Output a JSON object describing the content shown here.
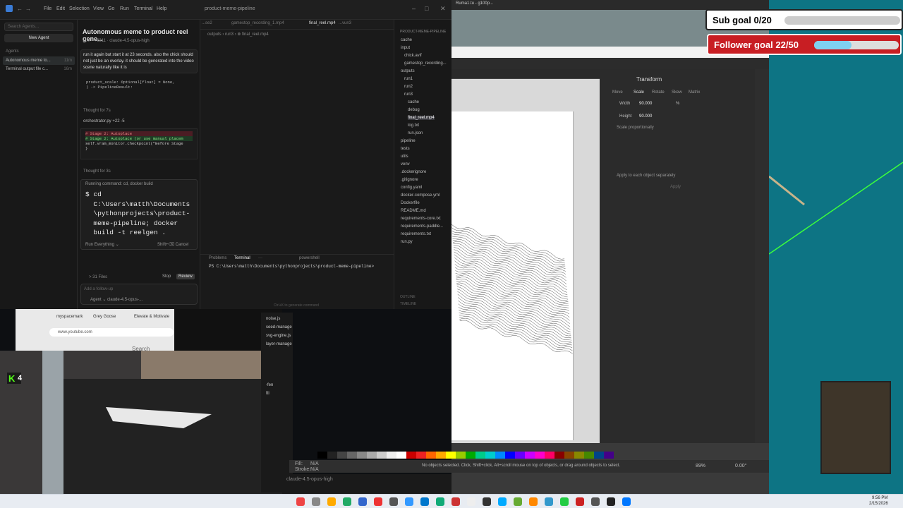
{
  "ide": {
    "menu": [
      "File",
      "Edit",
      "Selection",
      "View",
      "Go",
      "Run",
      "Terminal",
      "Help"
    ],
    "window_title": "product-meme-pipeline",
    "search_placeholder": "Search Agents...",
    "new_agent": "New Agent",
    "agents_label": "Agents",
    "agents": [
      {
        "label": "Autonomous meme to...",
        "time": "11m"
      },
      {
        "label": "Terminal output file c...",
        "time": "16m"
      }
    ],
    "chat": {
      "title": "Autonomous meme to product reel gene...",
      "meta": "11m · +6311 · claude-4.5-opus-high",
      "user_message": "run it again but start it at 23 seconds. also the chick should not just be an overlay. it should be generated into the video scene naturally like it is",
      "code_line1": "product_scale: Optional[float] = None,",
      "code_line2": ") -> PipelineResult:",
      "thought1": "Thought for 7s",
      "diff_file": "orchestrator.py  +22 -5",
      "diff_removed": "# Stage 2: Autoplace",
      "diff_added": "# Stage 2: Autoplace (or use manual placem",
      "diff_line3": "self.vram_monitor.checkpoint(\"Before Stage",
      "diff_line4": "}",
      "thought2": "Thought for 3s",
      "run_header": "Running command: cd, docker build",
      "run_code": "$ cd\n  C:\\Users\\matth\\Documents\n  \\pythonprojects\\product-\n  meme-pipeline; docker\n  build -t reelgen .",
      "run_everything": "Run Everything ⌄",
      "run_shortcut": "Shift+⌫ Cancel",
      "files_count": "> 31 Files",
      "stop": "Stop",
      "review": "Review",
      "followup_placeholder": "Add a follow-up",
      "agent_select": "Agent ⌄  claude-4.5-opus-..."
    },
    "editor": {
      "tabs": [
        "...se2",
        "gamestop_recording_1.mp4",
        "final_reel.mp4",
        "...vun3"
      ],
      "breadcrumb": "outputs › run3 › ⊗ final_reel.mp4",
      "terminal_tabs": [
        "Problems",
        "Terminal",
        "···"
      ],
      "shell": "powershell",
      "prompt": "PS C:\\Users\\matth\\Documents\\pythonprojects\\product-meme-pipeline>",
      "hint": "Ctrl+K to generate command"
    },
    "explorer": {
      "header": "PRODUCT-MEME-PIPELINE",
      "items": [
        "cache",
        "input",
        "chick.avif",
        "gamestop_recording...",
        "outputs",
        "run1",
        "run2",
        "run3",
        "cache",
        "debug",
        "final_reel.mp4",
        "log.txt",
        "run.json",
        "pipeline",
        "tests",
        "utils",
        "venv",
        ".dockerignore",
        ".gitignore",
        "config.yaml",
        "docker-compose.yml",
        "Dockerfile",
        "README.md",
        "requirements-core.txt",
        "requirements-paddle...",
        "requirements.txt",
        "run.py"
      ],
      "footer1": "OUTLINE",
      "footer2": "TIMELINE"
    }
  },
  "inkscape": {
    "title": "Ruma1.tu - g100p...",
    "panel_title": "Transform",
    "tabs": [
      "Move",
      "Scale",
      "Rotate",
      "Skew",
      "Matrix"
    ],
    "width_label": "Width",
    "width_value": "90.000",
    "height_label": "Height",
    "height_value": "90.000",
    "unit": "%",
    "scale_prop": "Scale proportionally",
    "apply_each": "Apply to each object separately",
    "apply": "Apply",
    "status_msg": "No objects selected. Click, Shift+click, Alt+scroll mouse on top of objects, or drag around objects to select.",
    "fill_label": "Fill:",
    "fill_value": "N/A",
    "stroke_label": "Stroke:",
    "stroke_value": "N/A",
    "zoom": "89%",
    "rotation": "0.00°"
  },
  "browser": {
    "tabs": [
      "myspacemark",
      "Grey Goose",
      "Elevate & Motivate"
    ],
    "url": "www.youtube.com",
    "search": "Search"
  },
  "side_list": [
    "noise.js",
    "seed-manage",
    "svg-engine.js",
    "layer-manage",
    "-fen",
    "ftl"
  ],
  "stream": {
    "kick_letter": "K",
    "kick_count": "4",
    "sub_goal": "Sub goal 0/20",
    "sub_progress": 0.0,
    "follower_goal": "Follower goal 22/50",
    "follower_progress": 0.44
  },
  "taskbar": {
    "time": "9:56 PM",
    "date": "2/15/2026",
    "status_model": "claude-4.5-opus-high"
  },
  "colors": {
    "accent_blue": "#0078d4",
    "kick_green": "#53fc18",
    "follower_red": "#c81e23",
    "goal_blue": "#7fd0f0"
  }
}
